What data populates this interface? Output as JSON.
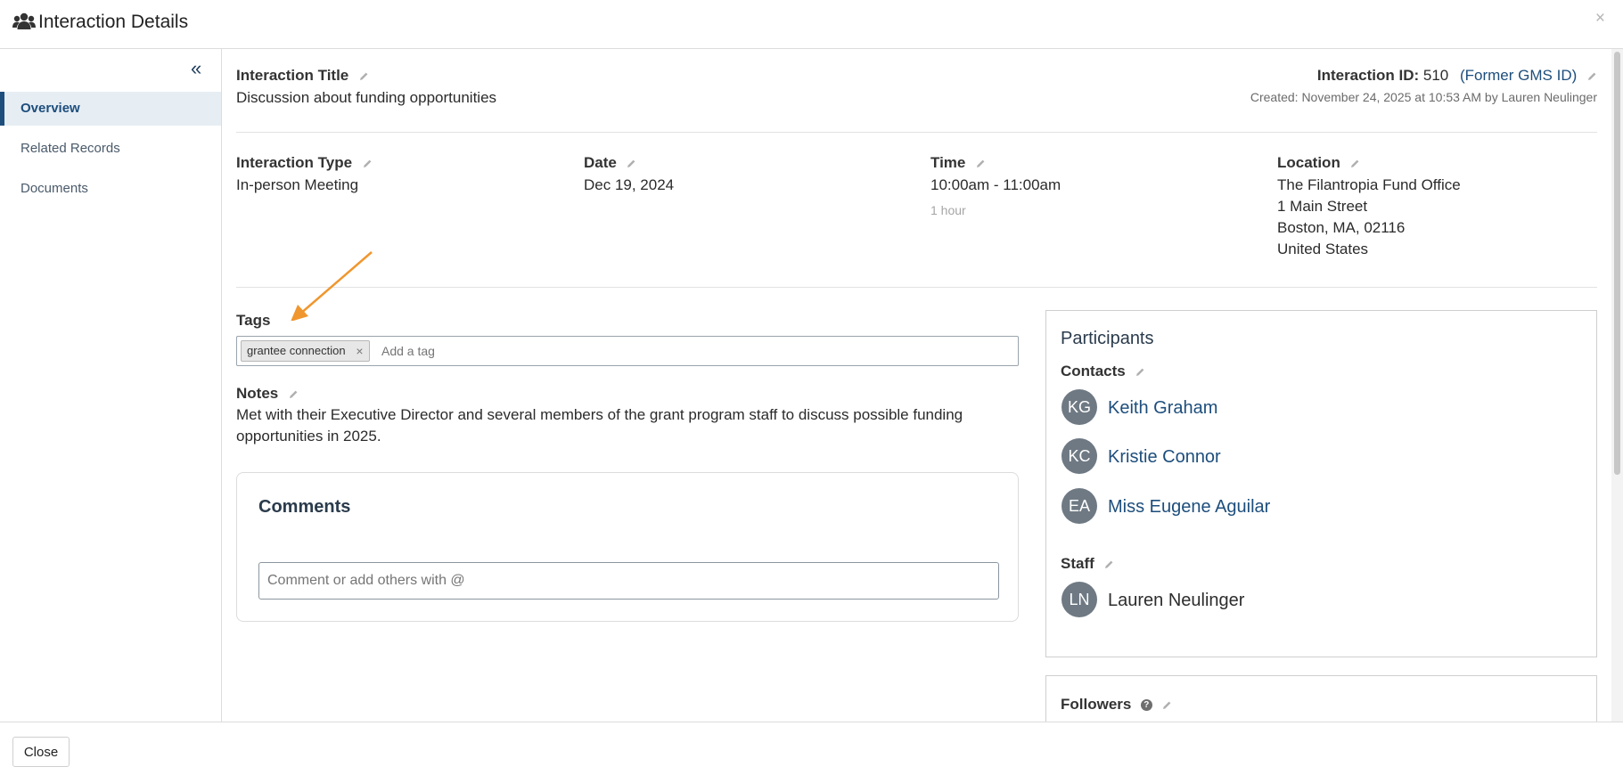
{
  "header": {
    "title": "Interaction Details",
    "close_glyph": "×"
  },
  "sidebar": {
    "collapse_glyph": "«",
    "items": [
      {
        "label": "Overview",
        "active": true
      },
      {
        "label": "Related Records",
        "active": false
      },
      {
        "label": "Documents",
        "active": false
      }
    ]
  },
  "interaction": {
    "title_label": "Interaction Title",
    "title_value": "Discussion about funding opportunities",
    "id_label": "Interaction ID:",
    "id_value": "510",
    "former_gms": "(Former GMS ID)",
    "created": "Created: November 24, 2025 at 10:53 AM by Lauren Neulinger",
    "type_label": "Interaction Type",
    "type_value": "In-person Meeting",
    "date_label": "Date",
    "date_value": "Dec 19, 2024",
    "time_label": "Time",
    "time_value": "10:00am - 11:00am",
    "duration": "1 hour",
    "location_label": "Location",
    "location_lines": [
      "The Filantropia Fund Office",
      "1 Main Street",
      "Boston, MA, 02116",
      "United States"
    ]
  },
  "tags": {
    "label": "Tags",
    "chips": [
      "grantee connection"
    ],
    "chip_remove_glyph": "×",
    "placeholder": "Add a tag"
  },
  "notes": {
    "label": "Notes",
    "line1": "Met with their Executive Director and several members of the grant program staff to discuss possible funding",
    "line2": "opportunities in 2025."
  },
  "comments": {
    "title": "Comments",
    "placeholder": "Comment or add others with @"
  },
  "participants": {
    "title": "Participants",
    "contacts_label": "Contacts",
    "contacts": [
      {
        "initials": "KG",
        "name": "Keith Graham"
      },
      {
        "initials": "KC",
        "name": "Kristie Connor"
      },
      {
        "initials": "EA",
        "name": "Miss Eugene Aguilar"
      }
    ],
    "staff_label": "Staff",
    "staff": [
      {
        "initials": "LN",
        "name": "Lauren Neulinger"
      }
    ]
  },
  "followers": {
    "label": "Followers",
    "help_glyph": "?"
  },
  "footer": {
    "close_label": "Close"
  },
  "colors": {
    "accent": "#1d4e7c",
    "annotation_arrow": "#f0962e",
    "avatar_bg": "#6e7983"
  },
  "icons": [
    "users-icon",
    "close-icon",
    "collapse-icon",
    "pencil-icon",
    "remove-tag-icon",
    "help-icon",
    "annotation-arrow-icon"
  ]
}
